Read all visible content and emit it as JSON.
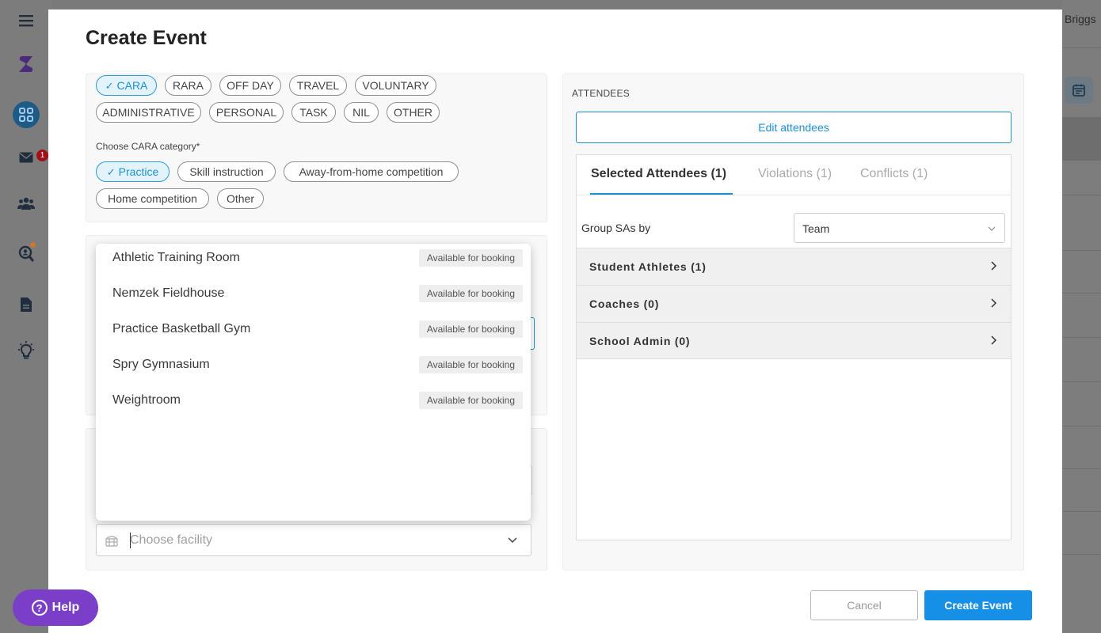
{
  "background": {
    "user_name": "Briggs",
    "mail_badge": "1"
  },
  "modal": {
    "title": "Create Event",
    "event_type_chips": [
      {
        "label": "CARA",
        "selected": true
      },
      {
        "label": "RARA",
        "selected": false
      },
      {
        "label": "OFF DAY",
        "selected": false
      },
      {
        "label": "TRAVEL",
        "selected": false
      },
      {
        "label": "VOLUNTARY",
        "selected": false
      },
      {
        "label": "ADMINISTRATIVE",
        "selected": false
      },
      {
        "label": "PERSONAL",
        "selected": false
      },
      {
        "label": "TASK",
        "selected": false
      },
      {
        "label": "NIL",
        "selected": false
      },
      {
        "label": "OTHER",
        "selected": false
      }
    ],
    "cara_category_label": "Choose CARA category*",
    "cara_category_chips": [
      {
        "label": "Practice",
        "selected": true
      },
      {
        "label": "Skill instruction",
        "selected": false
      },
      {
        "label": "Away-from-home competition",
        "selected": false
      },
      {
        "label": "Home competition",
        "selected": false
      },
      {
        "label": "Other",
        "selected": false
      }
    ],
    "facility_dropdown": {
      "options": [
        {
          "name": "Athletic Training Room",
          "status": "Available for booking"
        },
        {
          "name": "Nemzek Fieldhouse",
          "status": "Available for booking"
        },
        {
          "name": "Practice Basketball Gym",
          "status": "Available for booking"
        },
        {
          "name": "Spry Gymnasium",
          "status": "Available for booking"
        },
        {
          "name": "Weightroom",
          "status": "Available for booking"
        }
      ],
      "placeholder": "Choose facility"
    },
    "attendees": {
      "section_label": "ATTENDEES",
      "edit_button": "Edit attendees",
      "tabs": [
        {
          "label": "Selected Attendees (1)",
          "active": true
        },
        {
          "label": "Violations (1)",
          "active": false
        },
        {
          "label": "Conflicts (1)",
          "active": false
        }
      ],
      "group_by_label": "Group SAs by",
      "group_by_value": "Team",
      "groups": [
        {
          "label": "Student Athletes (1)"
        },
        {
          "label": "Coaches (0)"
        },
        {
          "label": "School Admin (0)"
        }
      ]
    },
    "cancel_button": "Cancel",
    "create_button": "Create Event"
  },
  "help_button": "Help",
  "colors": {
    "accent": "#1e8fcf",
    "primary_button": "#1590e6",
    "help": "#7b3ec9"
  }
}
